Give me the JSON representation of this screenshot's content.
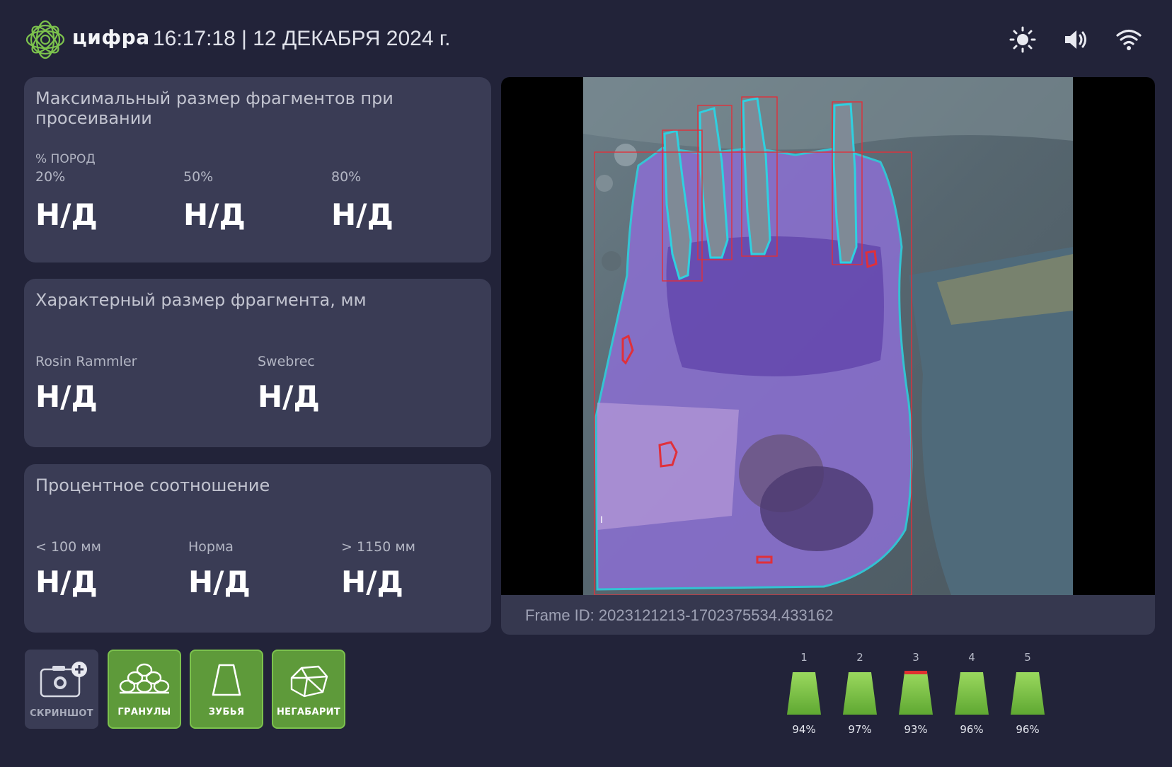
{
  "header": {
    "brand": "цифра",
    "datetime": "16:17:18 | 12 ДЕКАБРЯ 2024 г.",
    "icons": [
      "brightness-icon",
      "volume-icon",
      "wifi-icon"
    ]
  },
  "card_max_size": {
    "title": "Максимальный размер фрагментов при просеивании",
    "subtitle": "% ПОРОД",
    "columns": [
      {
        "label": "20%",
        "value": "Н/Д"
      },
      {
        "label": "50%",
        "value": "Н/Д"
      },
      {
        "label": "80%",
        "value": "Н/Д"
      }
    ]
  },
  "card_char_size": {
    "title": "Характерный размер фрагмента, мм",
    "columns": [
      {
        "label": "Rosin Rammler",
        "value": "Н/Д"
      },
      {
        "label": "Swebrec",
        "value": "Н/Д"
      }
    ]
  },
  "card_percent": {
    "title": "Процентное соотношение",
    "columns": [
      {
        "label": "< 100 мм",
        "value": "Н/Д"
      },
      {
        "label": "Норма",
        "value": "Н/Д"
      },
      {
        "label": "> 1150 мм",
        "value": "Н/Д"
      }
    ]
  },
  "video": {
    "frame_id": "Frame ID: 2023121213-1702375534.433162"
  },
  "buttons": {
    "screenshot": "СКРИНШОТ",
    "granules": "ГРАНУЛЫ",
    "teeth": "ЗУБЬЯ",
    "oversize": "НЕГАБАРИТ"
  },
  "teeth": [
    {
      "num": "1",
      "pct": "94%",
      "alert": false
    },
    {
      "num": "2",
      "pct": "97%",
      "alert": false
    },
    {
      "num": "3",
      "pct": "93%",
      "alert": true
    },
    {
      "num": "4",
      "pct": "96%",
      "alert": false
    },
    {
      "num": "5",
      "pct": "96%",
      "alert": false
    }
  ],
  "colors": {
    "background": "#222339",
    "card": "#3a3c55",
    "accent_green": "#7cc24d",
    "alert_red": "#e03030",
    "segmentation_fill": "#8a6fd0",
    "segmentation_outline": "#2fd0e0"
  }
}
